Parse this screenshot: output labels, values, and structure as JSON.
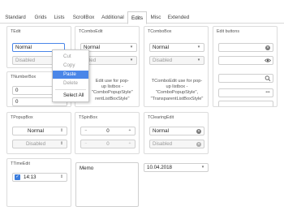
{
  "tabs": [
    "Standard",
    "Grids",
    "Lists",
    "ScrollBox",
    "Additional",
    "Edits",
    "Misc",
    "Extended"
  ],
  "active_tab": "Edits",
  "tedit": {
    "title": "TEdit",
    "value": "Normal",
    "disabled_value": "Disabled"
  },
  "context_menu": {
    "items": [
      "Cut",
      "Copy",
      "Paste",
      "Delete",
      "Select All"
    ],
    "highlighted": "Paste"
  },
  "tcomboedit": {
    "title": "TComboEdit",
    "value": "Normal",
    "disabled_value": "abled",
    "note_lines": [
      "Edit use for pop-",
      "up listbox -",
      "\"ComboPopupStyle\"",
      "rentListBoxStyle\""
    ]
  },
  "tcombobox": {
    "title": "TComboBox",
    "value": "Normal",
    "disabled_value": "Disabled",
    "note_lines": [
      "TComboEdit use for pop-",
      "up listbox -",
      "\"ComboPopupStyle\",",
      "\"TransparentListBoxStyle\""
    ]
  },
  "edit_buttons": {
    "title": "Edit buttons"
  },
  "tnumberbox": {
    "title": "TNumberBox",
    "value": "0",
    "value2": "0"
  },
  "tpopupbox": {
    "title": "TPopupBox",
    "value": "Normal",
    "disabled_value": "Disabled"
  },
  "tspinbox": {
    "title": "TSpinBox",
    "value": "0",
    "disabled_value": "0"
  },
  "tclearingedit": {
    "title": "TClearingEdit",
    "value": "Normal",
    "disabled_value": "Disabled"
  },
  "ttimeedit": {
    "title": "TTimeEdit",
    "value": "14:13"
  },
  "memo": {
    "text": "Memo"
  },
  "dateedit": {
    "value": "10.04.2018"
  },
  "colors": {
    "accent": "#4a86e8",
    "check": "#3b7ddd",
    "border": "#dcdcdc"
  }
}
